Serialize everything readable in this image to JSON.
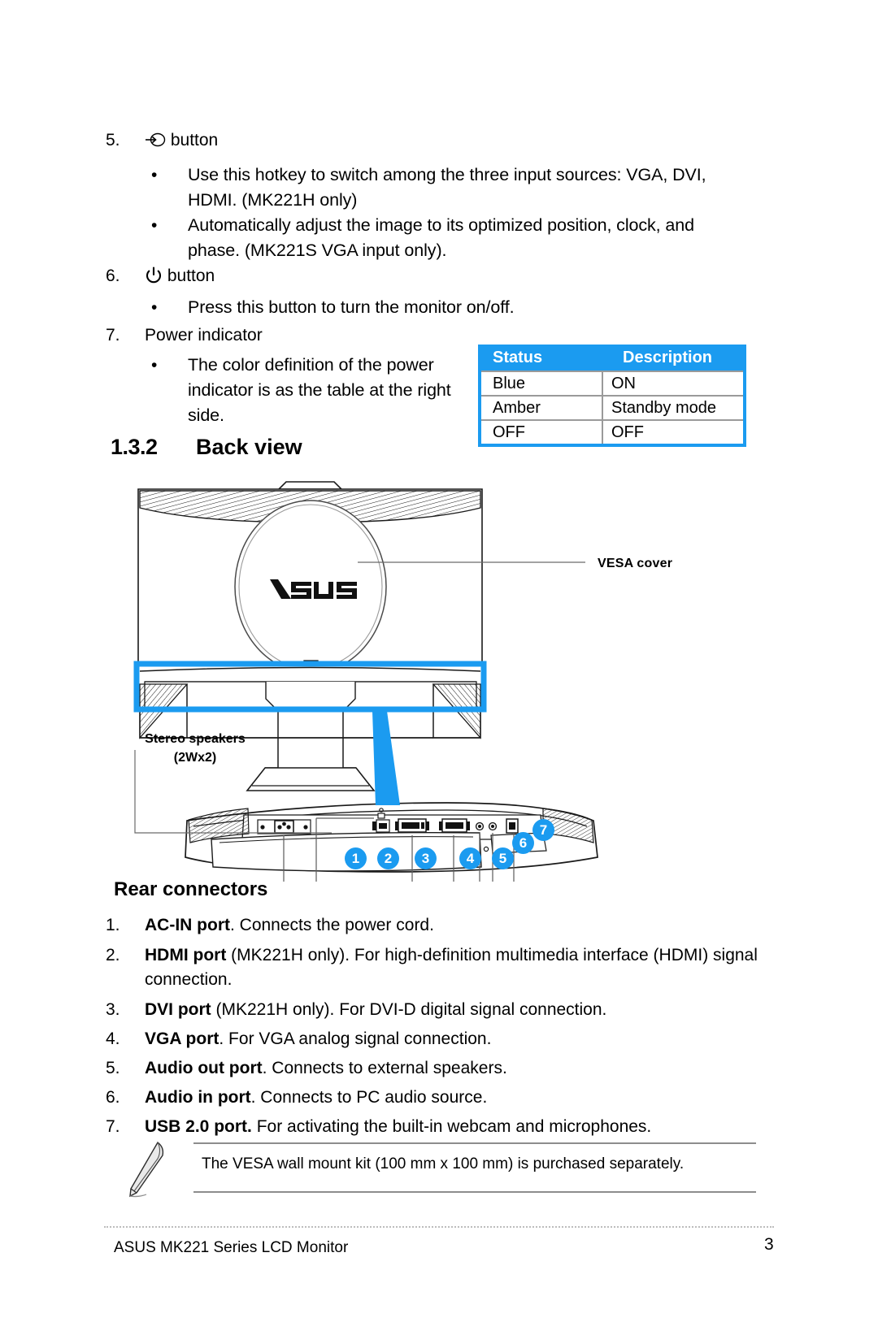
{
  "document": {
    "section_number": "1.3.2",
    "section_title": "Back view",
    "subsection_title": "Rear connectors"
  },
  "items": [
    {
      "number": "5.",
      "icon": "input-select-icon",
      "label": "button",
      "bullets": [
        "Use this hotkey to switch among the three input sources: VGA, DVI, HDMI. (MK221H only)",
        "Automatically adjust the image to its optimized position, clock, and phase. (MK221S VGA input only)."
      ]
    },
    {
      "number": "6.",
      "icon": "power-icon",
      "label": "button",
      "bullets": [
        "Press this button to turn the monitor on/off."
      ]
    },
    {
      "number": "7.",
      "icon": "",
      "label": "Power indicator",
      "bullets": [
        "The color definition of the power indicator is as the table at the right side."
      ]
    }
  ],
  "status_table": {
    "accent_color": "#1b9bf0",
    "headers": [
      "Status",
      "Description"
    ],
    "rows": [
      [
        "Blue",
        "ON"
      ],
      [
        "Amber",
        "Standby mode"
      ],
      [
        "OFF",
        "OFF"
      ]
    ]
  },
  "diagram": {
    "vesa_label": "VESA cover",
    "speakers_label_line1": "Stereo speakers",
    "speakers_label_line2": "(2Wx2)",
    "logo_text": "/ISUS",
    "badges": [
      "1",
      "2",
      "3",
      "4",
      "5",
      "6",
      "7"
    ],
    "highlight_color": "#1b9bf0"
  },
  "rear_connectors": [
    {
      "number": "1.",
      "bold": "AC-IN port",
      "rest": ". Connects the power cord."
    },
    {
      "number": "2.",
      "bold": "HDMI port",
      "rest": " (MK221H only). For high-definition multimedia interface (HDMI) signal connection."
    },
    {
      "number": "3.",
      "bold": "DVI port",
      "rest": " (MK221H only). For DVI-D digital signal connection."
    },
    {
      "number": "4.",
      "bold": "VGA port",
      "rest": ". For VGA analog signal connection."
    },
    {
      "number": "5.",
      "bold": "Audio out port",
      "rest": ". Connects to external speakers."
    },
    {
      "number": "6.",
      "bold": "Audio in port",
      "rest": ". Connects to PC audio source."
    },
    {
      "number": "7.",
      "bold": "USB 2.0 port.",
      "rest": " For activating the built-in webcam and microphones."
    }
  ],
  "note": {
    "icon": "pencil-note-icon",
    "text": "The VESA wall mount kit (100 mm x 100 mm) is purchased separately."
  },
  "footer": {
    "left": "ASUS MK221 Series LCD Monitor",
    "page_number": "3"
  }
}
